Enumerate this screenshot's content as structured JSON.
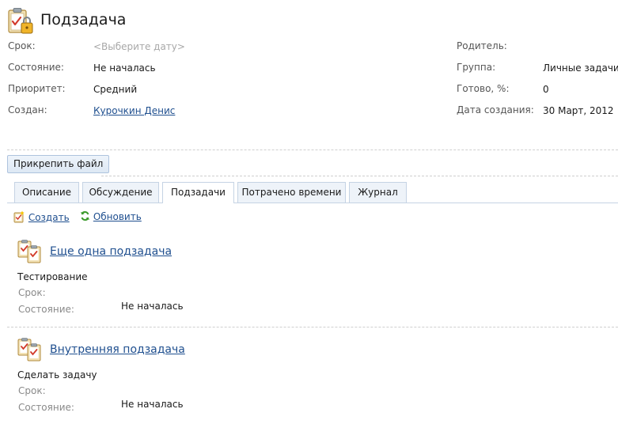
{
  "page": {
    "title": "Подзадача"
  },
  "fields_left": [
    {
      "label": "Срок:",
      "value": "<Выберите дату>",
      "kind": "placeholder"
    },
    {
      "label": "Состояние:",
      "value": "Не началась",
      "kind": "text"
    },
    {
      "label": "Приоритет:",
      "value": "Средний",
      "kind": "text"
    },
    {
      "label": "Создан:",
      "value": "Курочкин Денис",
      "kind": "link"
    }
  ],
  "fields_right": [
    {
      "label": "Родитель:",
      "value": ""
    },
    {
      "label": "Группа:",
      "value": "Личные задачи"
    },
    {
      "label": "Готово, %:",
      "value": "0"
    },
    {
      "label": "Дата создания:",
      "value": "30 Март, 2012"
    }
  ],
  "attach_button": {
    "label": "Прикрепить файл"
  },
  "tabs": [
    {
      "label": "Описание",
      "active": false
    },
    {
      "label": "Обсуждение",
      "active": false
    },
    {
      "label": "Подзадачи",
      "active": true
    },
    {
      "label": "Потрачено времени",
      "active": false
    },
    {
      "label": "Журнал",
      "active": false
    }
  ],
  "actions": {
    "create": "Создать",
    "refresh": "Обновить"
  },
  "subtasks": [
    {
      "title": "Еще одна подзадача",
      "description": "Тестирование",
      "deadline_label": "Срок:",
      "deadline_value": "",
      "status_label": "Состояние:",
      "status_value": "Не началась"
    },
    {
      "title": "Внутренняя подзадача",
      "description": "Сделать задачу",
      "deadline_label": "Срок:",
      "deadline_value": "",
      "status_label": "Состояние:",
      "status_value": "Не началась"
    }
  ],
  "icons": {
    "header": "clipboard-lock-icon",
    "create": "new-task-icon",
    "refresh": "refresh-icon",
    "task": "task-clipboard-icon"
  },
  "colors": {
    "link": "#1f4f8f",
    "tab_border": "#c5d3e4",
    "button_bg": "#dde8f4"
  }
}
